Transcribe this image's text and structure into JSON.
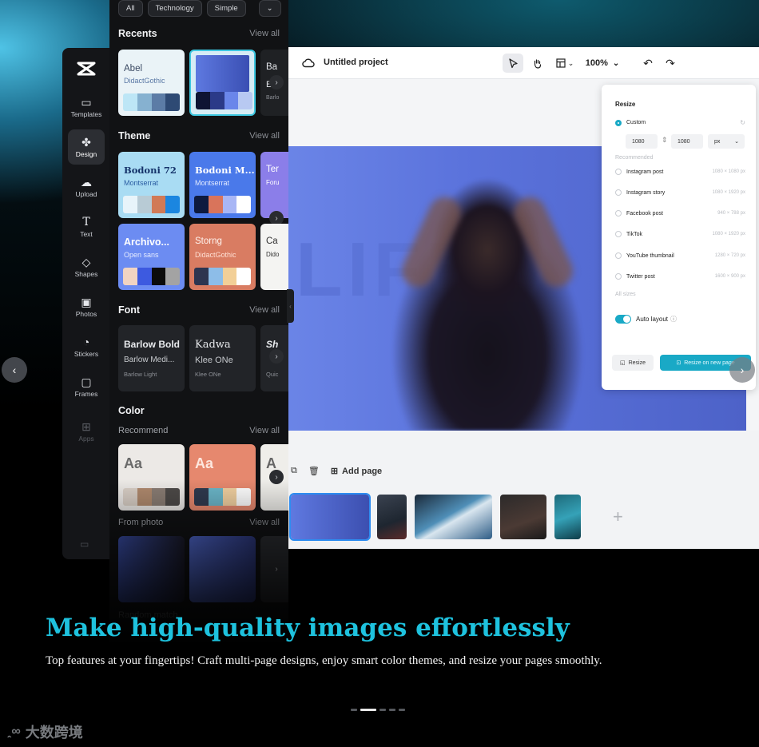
{
  "editor": {
    "project_title": "Untitled project",
    "zoom": "100%",
    "add_page_label": "Add page",
    "stage_ghost_text": "LIFE"
  },
  "resize_panel": {
    "title": "Resize",
    "custom_label": "Custom",
    "width_value": "1080",
    "height_value": "1080",
    "unit": "px",
    "recommended_label": "Recommended",
    "presets": [
      {
        "label": "Instagram post",
        "dims": "1080 × 1080 px"
      },
      {
        "label": "Instagram story",
        "dims": "1080 × 1920 px"
      },
      {
        "label": "Facebook post",
        "dims": "940 × 788 px"
      },
      {
        "label": "TikTok",
        "dims": "1080 × 1920 px"
      },
      {
        "label": "YouTube thumbnail",
        "dims": "1280 × 720 px"
      },
      {
        "label": "Twitter post",
        "dims": "1600 × 900 px"
      }
    ],
    "all_sizes_label": "All sizes",
    "auto_layout_label": "Auto layout",
    "resize_button": "Resize",
    "resize_new_page_button": "Resize on new page",
    "accent": "#19a9c6"
  },
  "rail": {
    "items": [
      {
        "label": "Templates",
        "icon": "templates-icon"
      },
      {
        "label": "Design",
        "icon": "design-icon"
      },
      {
        "label": "Upload",
        "icon": "upload-icon"
      },
      {
        "label": "Text",
        "icon": "text-icon"
      },
      {
        "label": "Shapes",
        "icon": "shapes-icon"
      },
      {
        "label": "Photos",
        "icon": "photos-icon"
      },
      {
        "label": "Stickers",
        "icon": "stickers-icon"
      },
      {
        "label": "Frames",
        "icon": "frames-icon"
      },
      {
        "label": "Apps",
        "icon": "apps-icon"
      }
    ]
  },
  "panel": {
    "chips": [
      "All",
      "Technology",
      "Simple"
    ],
    "view_all": "View all",
    "recents_title": "Recents",
    "theme_title": "Theme",
    "font_title": "Font",
    "color_title": "Color",
    "color_recommend": "Recommend",
    "color_from_photo": "From photo",
    "recents": [
      {
        "t1": "Abel",
        "t2": "DidactGothic"
      },
      {
        "t1": "",
        "t2": ""
      },
      {
        "t1": "Ba",
        "t2": "E"
      }
    ],
    "recents_small": "Barlo",
    "themes": [
      {
        "t1": "Bodoni 72",
        "t2": "Montserrat"
      },
      {
        "t1": "Bodoni M...",
        "t2": "Montserrat"
      },
      {
        "t1": "Ter",
        "t2": "Foru"
      },
      {
        "t1": "Archivo...",
        "t2": "Open sans"
      },
      {
        "t1": "Storng",
        "t2": "DidactGothic"
      },
      {
        "t1": "Ca",
        "t2": "Dido"
      }
    ],
    "fonts": [
      {
        "f1": "Barlow Bold",
        "f2": "Barlow Medi...",
        "f3": "Barlow Light"
      },
      {
        "f1": "Kadwa",
        "f2": "Klee ONe",
        "f3": "Klee ONe"
      },
      {
        "f1": "Sh",
        "f2": "",
        "f3": "Quic"
      }
    ],
    "color_cards": [
      "Aa",
      "Aa",
      "A"
    ],
    "bottom_partial": "Random match"
  },
  "carousel": {
    "headline": "Make high-quality images effortlessly",
    "subline": "Top features at your fingertips! Craft multi-page designs, enjoy smart color themes, and resize your pages smoothly.",
    "active_dot": 1,
    "dot_count": 5
  },
  "watermark": {
    "text": "大数跨境"
  }
}
